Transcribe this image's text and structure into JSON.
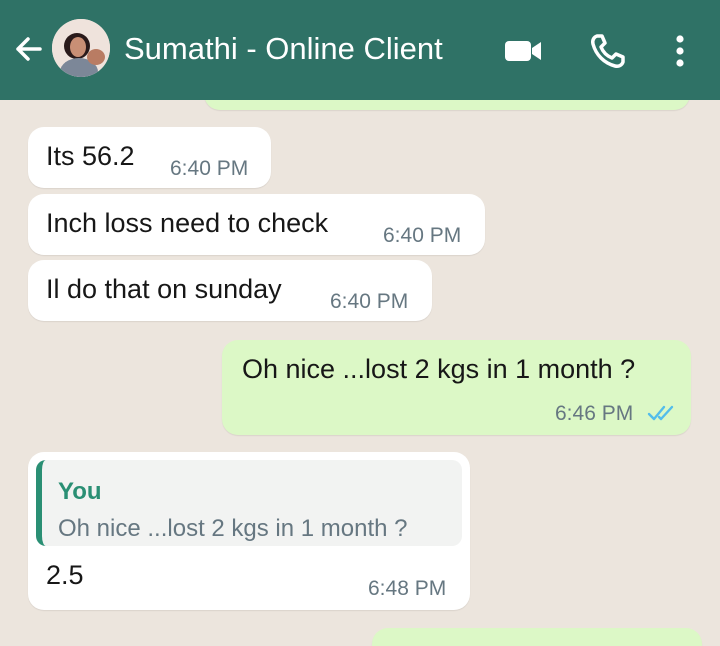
{
  "header": {
    "contact_name": "Sumathi - Online Client",
    "back_icon": "back-arrow-icon",
    "video_icon": "video-call-icon",
    "call_icon": "voice-call-icon",
    "menu_icon": "more-options-icon",
    "bar_color": "#2f7266"
  },
  "messages": [
    {
      "direction": "in",
      "text": "Its 56.2",
      "time": "6:40 PM"
    },
    {
      "direction": "in",
      "text": "Inch loss need to check",
      "time": "6:40 PM"
    },
    {
      "direction": "in",
      "text": "Il do that on sunday",
      "time": "6:40 PM"
    },
    {
      "direction": "out",
      "text": "Oh nice ...lost 2 kgs in 1 month ?",
      "time": "6:46 PM",
      "status": "read",
      "status_icon": "double-check-icon"
    },
    {
      "direction": "in",
      "reply_to": {
        "author": "You",
        "text": "Oh nice ...lost 2 kgs in 1 month ?"
      },
      "text": "2.5",
      "time": "6:48 PM"
    }
  ],
  "colors": {
    "incoming_bubble": "#ffffff",
    "outgoing_bubble": "#dcf8c6",
    "chat_background": "#ece5dd",
    "read_ticks": "#53bdeb"
  }
}
